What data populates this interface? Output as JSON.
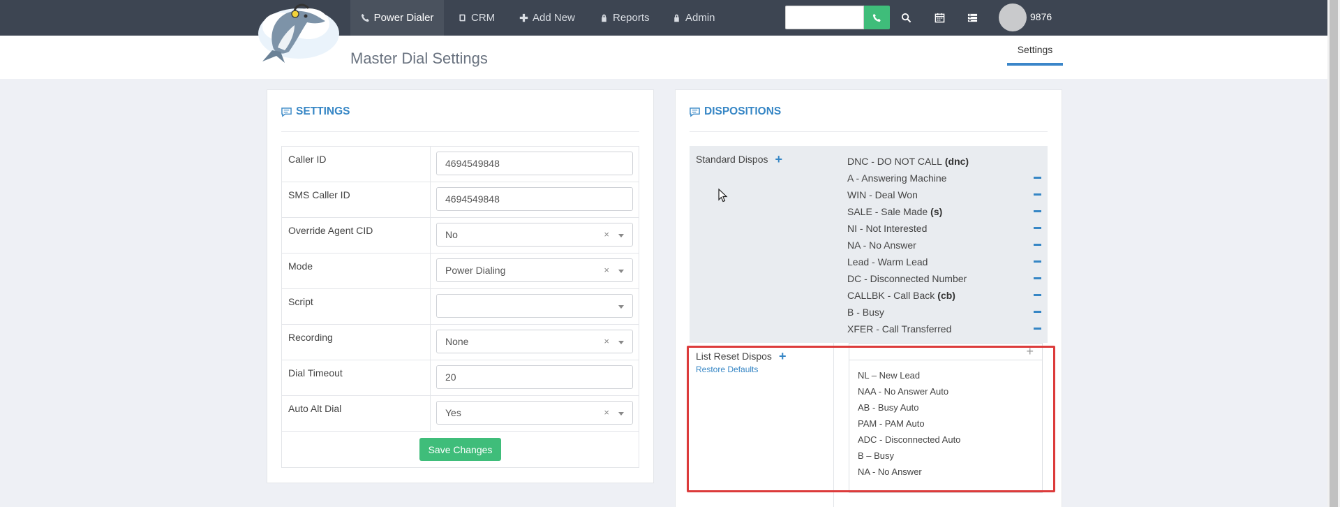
{
  "nav": {
    "items": [
      {
        "label": "Power Dialer",
        "icon": "phone-icon"
      },
      {
        "label": "CRM",
        "icon": "book-icon"
      },
      {
        "label": "Add New",
        "icon": "plus-icon"
      },
      {
        "label": "Reports",
        "icon": "lock-icon"
      },
      {
        "label": "Admin",
        "icon": "lock-icon"
      }
    ],
    "search_value": "",
    "user_id": "9876"
  },
  "header": {
    "title": "Master Dial Settings",
    "tab": "Settings"
  },
  "settings": {
    "heading": "SETTINGS",
    "rows": [
      {
        "label": "Caller ID",
        "type": "text",
        "value": "4694549848"
      },
      {
        "label": "SMS Caller ID",
        "type": "text",
        "value": "4694549848"
      },
      {
        "label": "Override Agent CID",
        "type": "select",
        "value": "No"
      },
      {
        "label": "Mode",
        "type": "select",
        "value": "Power Dialing"
      },
      {
        "label": "Script",
        "type": "select",
        "value": ""
      },
      {
        "label": "Recording",
        "type": "select",
        "value": "None"
      },
      {
        "label": "Dial Timeout",
        "type": "text",
        "value": "20"
      },
      {
        "label": "Auto Alt Dial",
        "type": "select",
        "value": "Yes"
      }
    ],
    "save_label": "Save Changes"
  },
  "dispositions": {
    "heading": "DISPOSITIONS",
    "standard_label": "Standard Dispos",
    "standard": [
      {
        "text": "DNC - DO NOT CALL",
        "tag": "(dnc)",
        "removable": false
      },
      {
        "text": "A - Answering Machine",
        "tag": "",
        "removable": true
      },
      {
        "text": "WIN - Deal Won",
        "tag": "",
        "removable": true
      },
      {
        "text": "SALE - Sale Made",
        "tag": "(s)",
        "removable": true
      },
      {
        "text": "NI - Not Interested",
        "tag": "",
        "removable": true
      },
      {
        "text": "NA - No Answer",
        "tag": "",
        "removable": true
      },
      {
        "text": "Lead - Warm Lead",
        "tag": "",
        "removable": true
      },
      {
        "text": "DC - Disconnected Number",
        "tag": "",
        "removable": true
      },
      {
        "text": "CALLBK - Call Back",
        "tag": "(cb)",
        "removable": true
      },
      {
        "text": "B - Busy",
        "tag": "",
        "removable": true
      },
      {
        "text": "XFER - Call Transferred",
        "tag": "",
        "removable": true
      }
    ],
    "reset_label": "List Reset Dispos",
    "restore_label": "Restore Defaults",
    "reset": [
      "NL – New Lead",
      "NAA - No Answer Auto",
      "AB - Busy Auto",
      "PAM - PAM Auto",
      "ADC - Disconnected Auto",
      "B – Busy",
      "NA - No Answer"
    ]
  },
  "colors": {
    "accent": "#3686c5",
    "success": "#3fbd7a",
    "navbar": "#3d4552",
    "highlight": "#dc3b3b"
  }
}
